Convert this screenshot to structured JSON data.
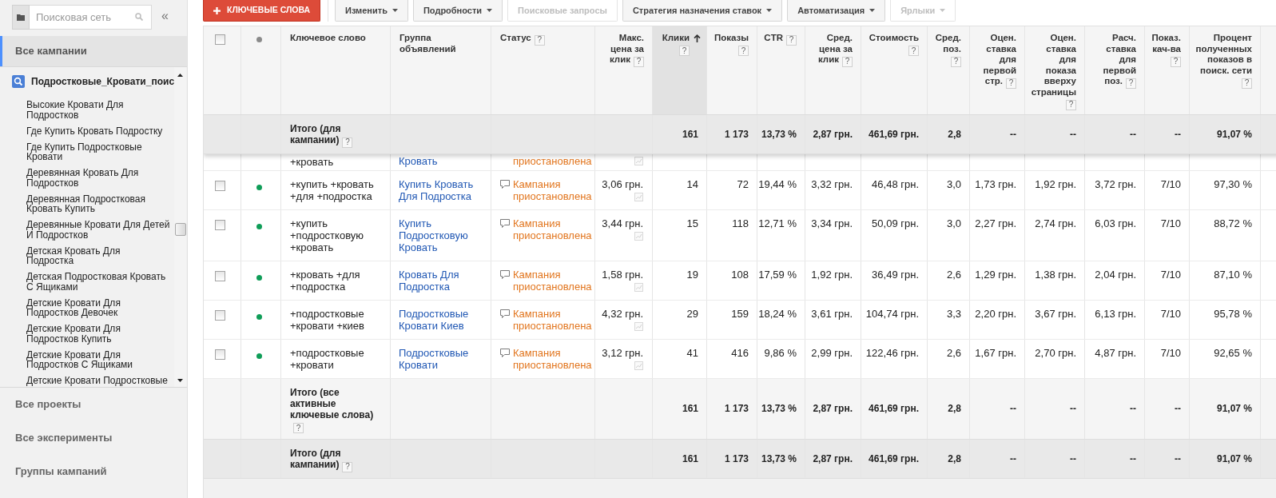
{
  "sidebar": {
    "search": {
      "placeholder": "Поисковая сеть"
    },
    "collapse": "«",
    "all_campaigns": {
      "label": "Все кампании",
      "selected": true
    },
    "campaign": {
      "name": "Подростковые_Кровати_поис",
      "children": [
        {
          "label": "Высокие Кровати Для Подростков"
        },
        {
          "label": "Где Купить Кровать Подростку"
        },
        {
          "label": "Где Купить Подростковые Кровати"
        },
        {
          "label": "Деревянная Кровать Для Подростков"
        },
        {
          "label": "Деревянная Подростковая Кровать Купить"
        },
        {
          "label": "Деревянные Кровати Для Детей И Подростков"
        },
        {
          "label": "Детская Кровать Для Подростка"
        },
        {
          "label": "Детская Подростковая Кровать С Ящиками"
        },
        {
          "label": "Детские Кровати Для Подростков Девочек"
        },
        {
          "label": "Детские Кровати Для Подростков Купить"
        },
        {
          "label": "Детские Кровати Для Подростков С Ящиками"
        },
        {
          "label": "Детские Кровати Подростковые"
        }
      ]
    },
    "nav": [
      {
        "label": "Все проекты",
        "selected": false
      },
      {
        "label": "Все эксперименты",
        "selected": false
      },
      {
        "label": "Группы кампаний",
        "selected": false
      }
    ]
  },
  "toolbar": {
    "add_button": "КЛЮЧЕВЫЕ СЛОВА",
    "buttons": [
      {
        "label": "Изменить",
        "dropdown": true,
        "disabled": false
      },
      {
        "label": "Подробности",
        "dropdown": true,
        "disabled": false
      },
      {
        "label": "Поисковые запросы",
        "dropdown": false,
        "disabled": true
      },
      {
        "label": "Стратегия назначения ставок",
        "dropdown": true,
        "disabled": false
      },
      {
        "label": "Автоматизация",
        "dropdown": true,
        "disabled": false
      },
      {
        "label": "Ярлыки",
        "dropdown": true,
        "disabled": true
      }
    ]
  },
  "table": {
    "columns": [
      {
        "kind": "checkbox",
        "checked": false,
        "sorted": false
      },
      {
        "kind": "status_dot",
        "sorted": false
      },
      {
        "kind": "keyword",
        "label": "Ключевое слово",
        "sorted": false
      },
      {
        "kind": "ad_group",
        "label": "Группа объявлений",
        "sorted": false
      },
      {
        "kind": "status",
        "label": "Статус",
        "help": "?",
        "sorted": false
      },
      {
        "kind": "bid",
        "label": "Макс. цена за клик",
        "help": "?",
        "sorted": false
      },
      {
        "kind": "number",
        "label": "Клики",
        "help": "?",
        "sorted": true
      },
      {
        "kind": "number",
        "label": "Показы",
        "help": "?",
        "sorted": false
      },
      {
        "kind": "number",
        "label": "CTR",
        "help": "?",
        "sorted": false
      },
      {
        "kind": "number",
        "label": "Сред. цена за клик",
        "help": "?",
        "sorted": false
      },
      {
        "kind": "number",
        "label": "Стоимость",
        "help": "?",
        "sorted": false
      },
      {
        "kind": "number",
        "label": "Сред. поз.",
        "help": "?",
        "sorted": false
      },
      {
        "kind": "number",
        "label": "Оцен. ставка для первой стр.",
        "help": "?",
        "sorted": false
      },
      {
        "kind": "number",
        "label": "Оцен. ставка для показа вверху страницы",
        "help": "?",
        "sorted": false
      },
      {
        "kind": "number",
        "label": "Расч. ставка для первой поз.",
        "help": "?",
        "sorted": false
      },
      {
        "kind": "number",
        "label": "Показ. кач-ва",
        "help": "?",
        "sorted": false
      },
      {
        "kind": "number",
        "label": "Процент полученных показов в поиск. сети",
        "help": "?",
        "sorted": false
      }
    ],
    "pinned_total": {
      "kind": "campaign",
      "label": "Итого (для кампании)",
      "help": "?",
      "metrics": [
        "161",
        "1 173",
        "13,73 %",
        "2,87 грн.",
        "461,69 грн.",
        "2,8",
        "--",
        "--",
        "--",
        "--",
        "91,07 %"
      ]
    },
    "partial_row": {
      "keyword": "+кровать",
      "ad_group": "Кровать",
      "status": "приостановлена"
    },
    "rows": [
      {
        "checked": false,
        "enabled": true,
        "keyword": "+купить +кровать +для +подростка",
        "ad_group": "Купить Кровать Для Подростка",
        "status": "Кампания приостановлена",
        "max_cpc": "3,06 грн.",
        "metrics": [
          "14",
          "72",
          "19,44 %",
          "3,32 грн.",
          "46,48 грн.",
          "3,0",
          "1,73 грн.",
          "1,92 грн.",
          "3,72 грн.",
          "7/10",
          "97,30 %"
        ]
      },
      {
        "checked": false,
        "enabled": true,
        "keyword": "+купить +подростковую +кровать",
        "ad_group": "Купить Подростковую Кровать",
        "status": "Кампания приостановлена",
        "max_cpc": "3,44 грн.",
        "metrics": [
          "15",
          "118",
          "12,71 %",
          "3,34 грн.",
          "50,09 грн.",
          "3,0",
          "2,27 грн.",
          "2,74 грн.",
          "6,03 грн.",
          "7/10",
          "88,72 %"
        ]
      },
      {
        "checked": false,
        "enabled": true,
        "keyword": "+кровать +для +подростка",
        "ad_group": "Кровать Для Подростка",
        "status": "Кампания приостановлена",
        "max_cpc": "1,58 грн.",
        "metrics": [
          "19",
          "108",
          "17,59 %",
          "1,92 грн.",
          "36,49 грн.",
          "2,6",
          "1,29 грн.",
          "1,38 грн.",
          "2,04 грн.",
          "7/10",
          "87,10 %"
        ]
      },
      {
        "checked": false,
        "enabled": true,
        "keyword": "+подростковые +кровати +киев",
        "ad_group": "Подростковые Кровати Киев",
        "status": "Кампания приостановлена",
        "max_cpc": "4,32 грн.",
        "metrics": [
          "29",
          "159",
          "18,24 %",
          "3,61 грн.",
          "104,74 грн.",
          "3,3",
          "2,20 грн.",
          "3,67 грн.",
          "6,13 грн.",
          "7/10",
          "95,78 %"
        ]
      },
      {
        "checked": false,
        "enabled": true,
        "keyword": "+подростковые +кровати",
        "ad_group": "Подростковые Кровати",
        "status": "Кампания приостановлена",
        "max_cpc": "3,12 грн.",
        "metrics": [
          "41",
          "416",
          "9,86 %",
          "2,99 грн.",
          "122,46 грн.",
          "2,6",
          "1,67 грн.",
          "2,70 грн.",
          "4,87 грн.",
          "7/10",
          "92,65 %"
        ]
      }
    ],
    "totals": [
      {
        "kind": "all_active",
        "label": "Итого (все активные ключевые слова)",
        "help": "?",
        "metrics": [
          "161",
          "1 173",
          "13,73 %",
          "2,87 грн.",
          "461,69 грн.",
          "2,8",
          "--",
          "--",
          "--",
          "--",
          "91,07 %"
        ]
      },
      {
        "kind": "campaign",
        "label": "Итого (для кампании)",
        "help": "?",
        "metrics": [
          "161",
          "1 173",
          "13,73 %",
          "2,87 грн.",
          "461,69 грн.",
          "2,8",
          "--",
          "--",
          "--",
          "--",
          "91,07 %"
        ]
      }
    ]
  }
}
